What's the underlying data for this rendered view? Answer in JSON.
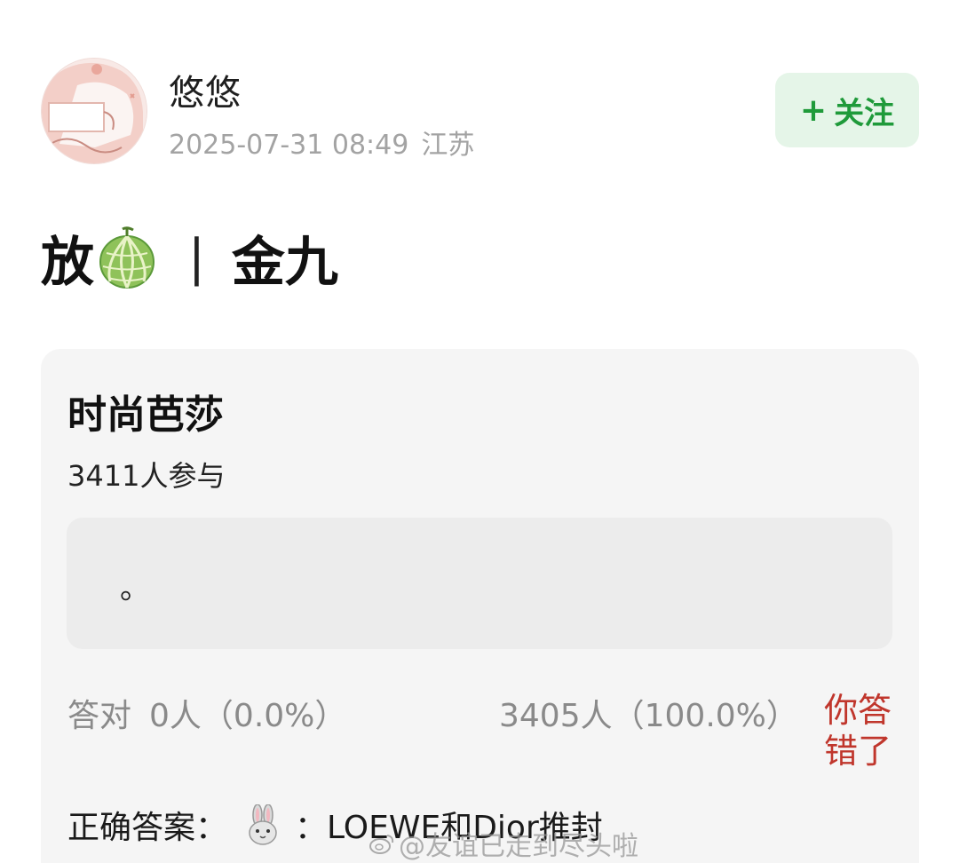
{
  "user": {
    "name": "悠悠",
    "date": "2025-07-31 08:49",
    "location": "江苏"
  },
  "follow": {
    "plus": "+",
    "label": "关注"
  },
  "post": {
    "title_prefix": "放",
    "emoji_icon": "melon-icon",
    "separator": "|",
    "title_suffix": "金九"
  },
  "quiz": {
    "title": "时尚芭莎",
    "participants": "3411人参与",
    "option_text": "。",
    "correct_label": "答对",
    "correct_value": "0人（0.0%）",
    "wrong_value": "3405人（100.0%）",
    "result_tag": "你答错了",
    "answer_label": "正确答案：",
    "answer_icon": "rabbit-icon",
    "answer_value": "：LOEWE和Dior推封"
  },
  "watermark": {
    "icon": "weibo-icon",
    "text": "@友谊已走到尽头啦"
  },
  "colors": {
    "follow_bg": "#e5f5e8",
    "follow_text": "#1f9a3a",
    "wrong_text": "#c0362c",
    "card_bg": "#f5f5f5"
  }
}
